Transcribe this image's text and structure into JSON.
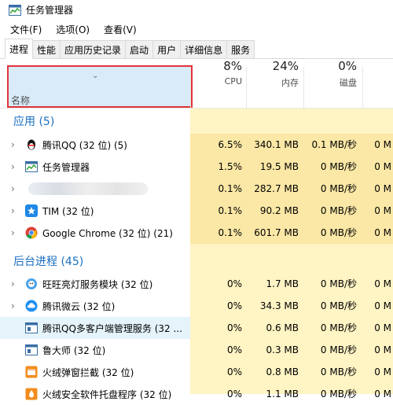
{
  "window": {
    "title": "任务管理器"
  },
  "menu": [
    "文件(F)",
    "选项(O)",
    "查看(V)"
  ],
  "tabs": [
    "进程",
    "性能",
    "应用历史记录",
    "启动",
    "用户",
    "详细信息",
    "服务"
  ],
  "columns": {
    "name": "名称",
    "cpu": {
      "pct": "8%",
      "label": "CPU"
    },
    "mem": {
      "pct": "24%",
      "label": "内存"
    },
    "disk": {
      "pct": "0%",
      "label": "磁盘"
    }
  },
  "groups": {
    "apps": "应用 (5)",
    "background": "后台进程 (45)"
  },
  "apps": [
    {
      "name": "腾讯QQ (32 位) (5)",
      "cpu": "6.5%",
      "mem": "340.1 MB",
      "disk": "0.1 MB/秒",
      "net": "0 M",
      "icon": "qq-penguin-icon"
    },
    {
      "name": "任务管理器",
      "cpu": "1.5%",
      "mem": "19.5 MB",
      "disk": "0 MB/秒",
      "net": "0 M",
      "icon": "task-manager-icon"
    },
    {
      "name": "",
      "cpu": "0.1%",
      "mem": "282.7 MB",
      "disk": "0 MB/秒",
      "net": "0 M",
      "icon": "blurred-app-icon"
    },
    {
      "name": "TIM (32 位)",
      "cpu": "0.1%",
      "mem": "90.2 MB",
      "disk": "0 MB/秒",
      "net": "0 M",
      "icon": "tim-icon"
    },
    {
      "name": "Google Chrome (32 位) (21)",
      "cpu": "0.1%",
      "mem": "601.7 MB",
      "disk": "0 MB/秒",
      "net": "0 M",
      "icon": "chrome-icon"
    }
  ],
  "background": [
    {
      "name": "旺旺亮灯服务模块 (32 位)",
      "cpu": "0%",
      "mem": "1.7 MB",
      "disk": "0 MB/秒",
      "net": "0 M",
      "icon": "wangwang-icon"
    },
    {
      "name": "腾讯微云 (32 位)",
      "cpu": "0%",
      "mem": "34.3 MB",
      "disk": "0 MB/秒",
      "net": "0 M",
      "icon": "weiyun-cloud-icon"
    },
    {
      "name": "腾讯QQ多客户端管理服务 (32 ...",
      "cpu": "0%",
      "mem": "0.6 MB",
      "disk": "0 MB/秒",
      "net": "0 M",
      "icon": "service-window-icon"
    },
    {
      "name": "鲁大师 (32 位)",
      "cpu": "0%",
      "mem": "0.3 MB",
      "disk": "0 MB/秒",
      "net": "0 M",
      "icon": "ludashi-icon"
    },
    {
      "name": "火绒弹窗拦截 (32 位)",
      "cpu": "0%",
      "mem": "0.8 MB",
      "disk": "0 MB/秒",
      "net": "0 M",
      "icon": "huorong-popup-icon"
    },
    {
      "name": "火绒安全软件托盘程序 (32 位)",
      "cpu": "0%",
      "mem": "1.1 MB",
      "disk": "0 MB/秒",
      "net": "0 M",
      "icon": "huorong-tray-icon"
    }
  ],
  "colors": {
    "accent": "#1a6fc2",
    "highlight": "#e0343a",
    "cell_bg_strong": "#fbe8a6",
    "cell_bg_light": "#fff4c4",
    "header_selected": "#d9ebf9"
  }
}
